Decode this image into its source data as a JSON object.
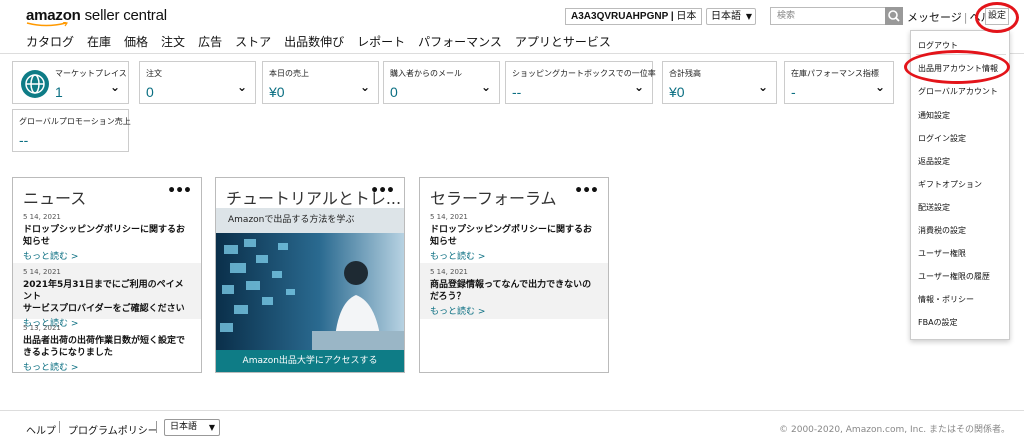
{
  "header": {
    "logo_bold": "amazon",
    "logo_rest": " seller central",
    "account_id": "A3A3QVRUAHPGNP",
    "account_region": "日本",
    "language": "日本語",
    "search_placeholder": "検索",
    "messages": "メッセージ",
    "help": "ヘル",
    "settings": "設定"
  },
  "nav": [
    "カタログ",
    "在庫",
    "価格",
    "注文",
    "広告",
    "ストア",
    "出品数伸び",
    "レポート",
    "パフォーマンス",
    "アプリとサービス"
  ],
  "tiles": [
    {
      "label": "マーケットプレイス",
      "value": "1"
    },
    {
      "label": "注文",
      "value": "0"
    },
    {
      "label": "本日の売上",
      "value": "¥0"
    },
    {
      "label": "購入者からのメール",
      "value": "0"
    },
    {
      "label": "ショッピングカートボックスでの一位率",
      "value": "--"
    },
    {
      "label": "合計残高",
      "value": "¥0"
    },
    {
      "label": "在庫パフォーマンス指標",
      "value": "-"
    },
    {
      "label": "グローバルプロモーション売上",
      "value": "--"
    }
  ],
  "news": {
    "title": "ニュース",
    "items": [
      {
        "date": "5 14, 2021",
        "headline1": "ドロップシッピングポリシーに関するお",
        "headline2": "知らせ",
        "more": "もっと読む >"
      },
      {
        "date": "5 14, 2021",
        "headline1": "2021年5月31日までにご利用のペイメント",
        "headline2": "サービスプロバイダーをご確認ください",
        "more": "もっと読む >"
      },
      {
        "date": "5 13, 2021",
        "headline1": "出品者出荷の出荷作業日数が短く設定で",
        "headline2": "きるようになりました",
        "more": "もっと読む >"
      }
    ]
  },
  "tutorial": {
    "title": "チュートリアルとトレ...",
    "subtitle": "Amazonで出品する方法を学ぶ",
    "button": "Amazon出品大学にアクセスする"
  },
  "forum": {
    "title": "セラーフォーラム",
    "items": [
      {
        "date": "5 14, 2021",
        "headline1": "ドロップシッピングポリシーに関するお",
        "headline2": "知らせ",
        "more": "もっと読む >"
      },
      {
        "date": "5 14, 2021",
        "headline1": "商品登録情報ってなんで出力できないの",
        "headline2": "だろう？",
        "more": "もっと読む >"
      }
    ]
  },
  "dropdown": [
    "ログアウト",
    "出品用アカウント情報",
    "グローバルアカウント",
    "通知設定",
    "ログイン設定",
    "返品設定",
    "ギフトオプション",
    "配送設定",
    "消費税の設定",
    "ユーザー権限",
    "ユーザー権限の履歴",
    "情報・ポリシー",
    "FBAの設定"
  ],
  "footer": {
    "help": "ヘルプ",
    "policy": "プログラムポリシー",
    "language": "日本語",
    "copyright": "© 2000-2020, Amazon.com, Inc. またはその関係者。"
  },
  "colors": {
    "accent": "#0e7c86",
    "value": "#0b6f82",
    "highlight": "#e3141a"
  }
}
